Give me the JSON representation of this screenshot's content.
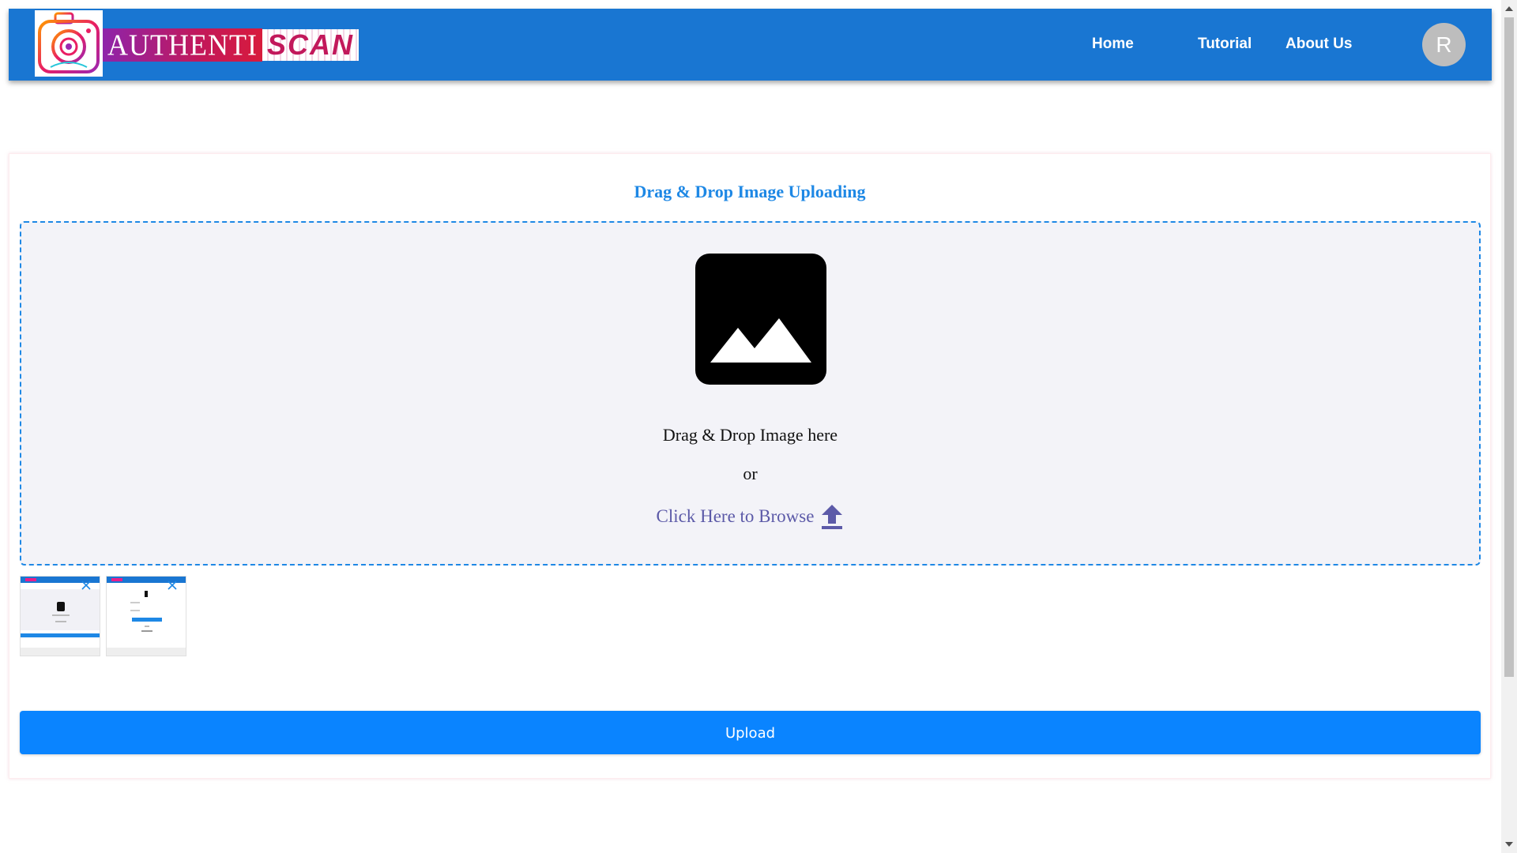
{
  "brand": {
    "name_part1": "AUTHENTI",
    "name_part2": "SCAN",
    "logo_icon": "camera-logo-icon"
  },
  "nav": {
    "links": [
      {
        "label": "Home"
      },
      {
        "label": "Tutorial"
      },
      {
        "label": "About Us"
      }
    ],
    "avatar_initial": "R"
  },
  "uploader": {
    "title": "Drag & Drop Image Uploading",
    "drop_text": "Drag & Drop Image here",
    "or_text": "or",
    "browse_label": "Click Here to Browse",
    "browse_icon": "upload-arrow-icon",
    "placeholder_icon": "image-icon",
    "thumbnails": [
      {
        "name": "thumbnail-1",
        "close_icon": "close-icon"
      },
      {
        "name": "thumbnail-2",
        "close_icon": "close-icon"
      }
    ],
    "upload_label": "Upload"
  },
  "colors": {
    "navbar": "#1976d2",
    "accent": "#1e88e5",
    "upload_button": "#0a84ff",
    "browse_text": "#5c5aa8",
    "dropzone_bg": "#f3f3f8"
  }
}
